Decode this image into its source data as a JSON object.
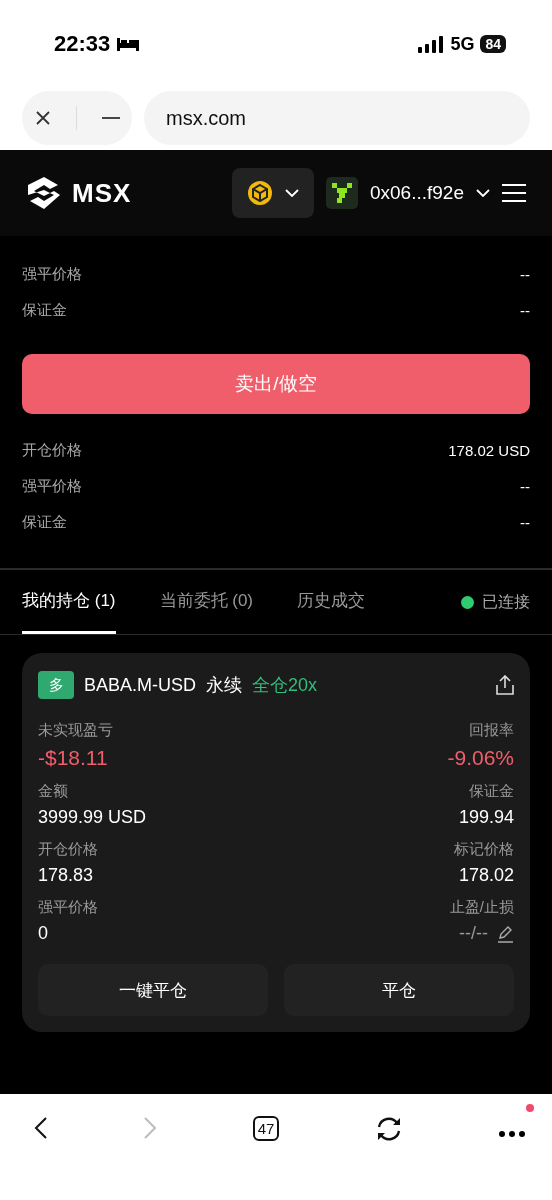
{
  "status_bar": {
    "time": "22:33",
    "network": "5G",
    "battery": "84"
  },
  "browser_bar": {
    "url": "msx.com"
  },
  "header": {
    "logo": "MSX",
    "wallet": "0x06...f92e"
  },
  "order_info_top": [
    {
      "label": "强平价格",
      "value": "--"
    },
    {
      "label": "保证金",
      "value": "--"
    }
  ],
  "sell_button": "卖出/做空",
  "order_info": [
    {
      "label": "开仓价格",
      "value": "178.02 USD"
    },
    {
      "label": "强平价格",
      "value": "--"
    },
    {
      "label": "保证金",
      "value": "--"
    }
  ],
  "tabs": [
    {
      "label": "我的持仓 (1)",
      "selected": true
    },
    {
      "label": "当前委托 (0)",
      "selected": false
    },
    {
      "label": "历史成交",
      "selected": false
    }
  ],
  "connection": {
    "label": "已连接",
    "color": "#2ecc71"
  },
  "position": {
    "side": "多",
    "long": true,
    "symbol": "BABA.M-USD",
    "type": "永续",
    "margin_mode": "全仓20x",
    "stats": [
      {
        "label": "未实现盈亏",
        "value": "-$18.11",
        "kind": "loss"
      },
      {
        "label": "回报率",
        "value": "-9.06%",
        "kind": "loss"
      },
      {
        "label": "金额",
        "value": "3999.99 USD",
        "kind": "plain"
      },
      {
        "label": "保证金",
        "value": "199.94",
        "kind": "plain"
      },
      {
        "label": "开仓价格",
        "value": "178.83",
        "kind": "plain"
      },
      {
        "label": "标记价格",
        "value": "178.02",
        "kind": "plain"
      },
      {
        "label": "强平价格",
        "value": "0",
        "kind": "plain"
      },
      {
        "label": "止盈/止损",
        "value": "--/--",
        "kind": "edit"
      }
    ],
    "buttons": [
      "一键平仓",
      "平仓"
    ]
  },
  "bottom_bar": {
    "tab_count": "47",
    "back_disabled": false,
    "forward_disabled": true,
    "menu_notification": true
  }
}
